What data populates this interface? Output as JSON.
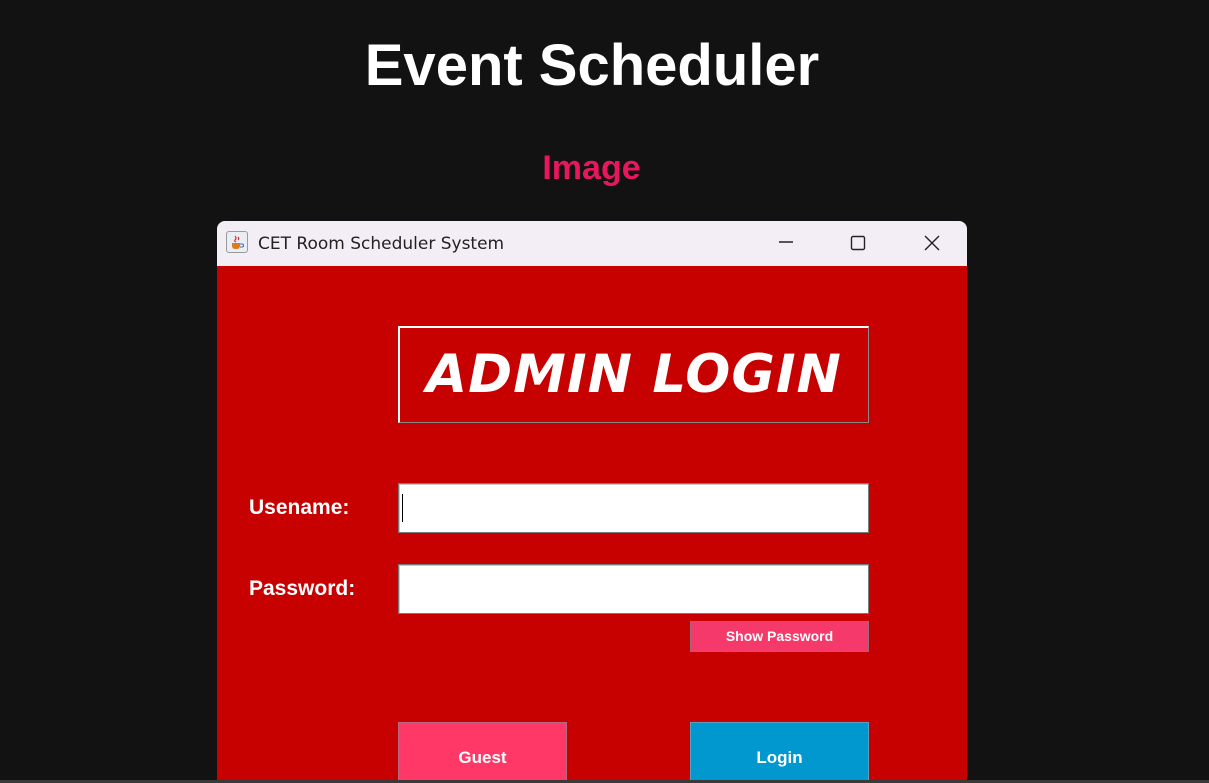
{
  "page": {
    "title": "Event Scheduler",
    "subtitle": "Image"
  },
  "window": {
    "title": "CET Room Scheduler System",
    "icon": "java-cup-icon",
    "controls": [
      "minimize-icon",
      "maximize-icon",
      "close-icon"
    ]
  },
  "login_form": {
    "banner": "ADMIN LOGIN",
    "username_label": "Usename:",
    "username_value": "",
    "password_label": "Password:",
    "password_value": "",
    "show_password_label": "Show Password",
    "guest_label": "Guest",
    "login_label": "Login"
  },
  "colors": {
    "page_background": "#121212",
    "subtitle": "#e8175d",
    "form_background": "#c70000",
    "guest_button": "#ff3868",
    "show_password_button": "#f5396a",
    "login_button": "#0197cf",
    "titlebar": "#f3eef6"
  }
}
